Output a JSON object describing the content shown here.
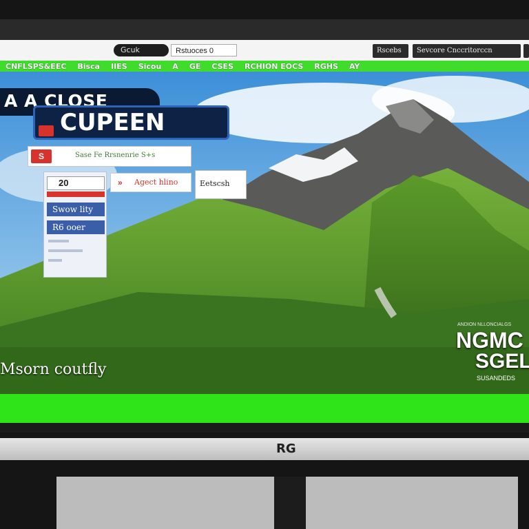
{
  "browser": {
    "tab_label": "Gcuk",
    "address_value": "Rstuoces 0",
    "right_button_1": "Rscebs",
    "right_button_2": "Sevcore Cnccritorccn",
    "right_button_3": ""
  },
  "nav": {
    "items": [
      "CNFLSPS&EEC",
      "Bisca",
      "IIES",
      "Sicou",
      "A",
      "GE",
      "CSES",
      "RCHION EOCS",
      "RGHS",
      "AY"
    ]
  },
  "overlay": {
    "banner_line1": "A A CLOSE",
    "banner_line2": "CUPEEN",
    "panel_logo": "S",
    "panel_text": "Sase   Fe   Rrsnenrie   S+s",
    "sidebar_head": "20",
    "sidebar_items": [
      "Swow lity",
      "R6 ooer"
    ],
    "link_arrow": "»",
    "link_label": "Agect hlino",
    "search_label": "Eetscsh",
    "caption": "Msorn coutfly",
    "badge_small": "ANDION NLLONCIALGS",
    "badge_line1": "NGMC",
    "badge_line2": "SGEL",
    "badge_line3": "SUSANDEDS"
  },
  "bezel": {
    "brand": "RG"
  },
  "colors": {
    "nav_green": "#3fdc2c",
    "band_green": "#2fe418",
    "banner_navy": "#0d2244",
    "accent_red": "#d8322c",
    "sidebar_blue": "#3a5fa8"
  }
}
